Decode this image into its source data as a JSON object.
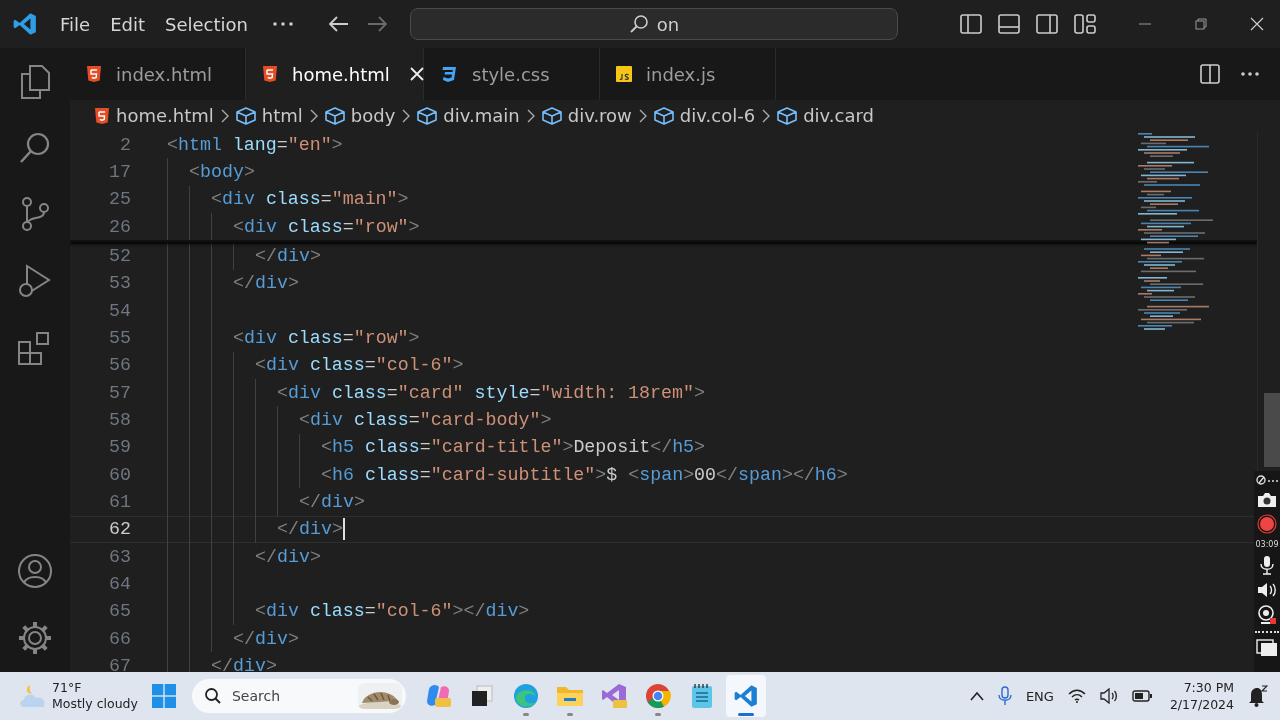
{
  "menu": [
    "File",
    "Edit",
    "Selection"
  ],
  "command_center": {
    "text": "on"
  },
  "tabs": [
    {
      "label": "index.html",
      "kind": "html",
      "selected": false
    },
    {
      "label": "home.html",
      "kind": "html",
      "selected": true
    },
    {
      "label": "style.css",
      "kind": "css",
      "selected": false
    },
    {
      "label": "index.js",
      "kind": "js",
      "selected": false
    }
  ],
  "breadcrumbs": [
    {
      "label": "home.html",
      "kind": "file"
    },
    {
      "label": "html",
      "kind": "element"
    },
    {
      "label": "body",
      "kind": "element"
    },
    {
      "label": "div.main",
      "kind": "element"
    },
    {
      "label": "div.row",
      "kind": "element"
    },
    {
      "label": "div.col-6",
      "kind": "element"
    },
    {
      "label": "div.card",
      "kind": "element"
    }
  ],
  "sticky_lines": [
    {
      "n": "2",
      "code": [
        {
          "p": "<"
        },
        {
          "tag": "html"
        },
        {
          "attr": " lang"
        },
        {
          "eq": "="
        },
        {
          "str": "\"en\""
        },
        {
          "p": ">"
        }
      ]
    },
    {
      "n": "17",
      "code": [
        {
          "p": "  <"
        },
        {
          "tag": "body"
        },
        {
          "p": ">"
        }
      ]
    },
    {
      "n": "25",
      "code": [
        {
          "p": "    <"
        },
        {
          "tag": "div"
        },
        {
          "attr": " class"
        },
        {
          "eq": "="
        },
        {
          "str": "\"main\""
        },
        {
          "p": ">"
        }
      ]
    },
    {
      "n": "26",
      "code": [
        {
          "p": "      <"
        },
        {
          "tag": "div"
        },
        {
          "attr": " class"
        },
        {
          "eq": "="
        },
        {
          "str": "\"row\""
        },
        {
          "p": ">"
        }
      ]
    }
  ],
  "lines": [
    {
      "n": "52",
      "current": false,
      "code": [
        {
          "p": "        </"
        },
        {
          "tag": "div"
        },
        {
          "p": ">"
        }
      ]
    },
    {
      "n": "53",
      "current": false,
      "code": [
        {
          "p": "      </"
        },
        {
          "tag": "div"
        },
        {
          "p": ">"
        }
      ]
    },
    {
      "n": "54",
      "current": false
    },
    {
      "n": "55",
      "current": false,
      "code": [
        {
          "p": "      <"
        },
        {
          "tag": "div"
        },
        {
          "attr": " class"
        },
        {
          "eq": "="
        },
        {
          "str": "\"row\""
        },
        {
          "p": ">"
        }
      ]
    },
    {
      "n": "56",
      "current": false,
      "code": [
        {
          "p": "        <"
        },
        {
          "tag": "div"
        },
        {
          "attr": " class"
        },
        {
          "eq": "="
        },
        {
          "str": "\"col-6\""
        },
        {
          "p": ">"
        }
      ]
    },
    {
      "n": "57",
      "current": false,
      "code": [
        {
          "p": "          <"
        },
        {
          "tag": "div"
        },
        {
          "attr": " class"
        },
        {
          "eq": "="
        },
        {
          "str": "\"card\""
        },
        {
          "attr": " style"
        },
        {
          "eq": "="
        },
        {
          "str": "\"width: 18rem\""
        },
        {
          "p": ">"
        }
      ]
    },
    {
      "n": "58",
      "current": false,
      "code": [
        {
          "p": "            <"
        },
        {
          "tag": "div"
        },
        {
          "attr": " class"
        },
        {
          "eq": "="
        },
        {
          "str": "\"card-body\""
        },
        {
          "p": ">"
        }
      ]
    },
    {
      "n": "59",
      "current": false,
      "code": [
        {
          "p": "              <"
        },
        {
          "tag": "h5"
        },
        {
          "attr": " class"
        },
        {
          "eq": "="
        },
        {
          "str": "\"card-title\""
        },
        {
          "p": ">"
        },
        {
          "text": "Deposit"
        },
        {
          "p": "</"
        },
        {
          "tag": "h5"
        },
        {
          "p": ">"
        }
      ]
    },
    {
      "n": "60",
      "current": false,
      "code": [
        {
          "p": "              <"
        },
        {
          "tag": "h6"
        },
        {
          "attr": " class"
        },
        {
          "eq": "="
        },
        {
          "str": "\"card-subtitle\""
        },
        {
          "p": ">"
        },
        {
          "text": "$ "
        },
        {
          "p": "<"
        },
        {
          "tag": "span"
        },
        {
          "p": ">"
        },
        {
          "text": "00"
        },
        {
          "p": "</"
        },
        {
          "tag": "span"
        },
        {
          "p": ">"
        },
        {
          "p": "</"
        },
        {
          "tag": "h6"
        },
        {
          "p": ">"
        }
      ]
    },
    {
      "n": "61",
      "current": false,
      "code": [
        {
          "p": "            </"
        },
        {
          "tag": "div"
        },
        {
          "p": ">"
        }
      ]
    },
    {
      "n": "62",
      "current": true,
      "code": [
        {
          "p": "          </"
        },
        {
          "tag": "div"
        },
        {
          "p": ">"
        }
      ]
    },
    {
      "n": "63",
      "current": false,
      "code": [
        {
          "p": "        </"
        },
        {
          "tag": "div"
        },
        {
          "p": ">"
        }
      ]
    },
    {
      "n": "64",
      "current": false
    },
    {
      "n": "65",
      "current": false,
      "code": [
        {
          "p": "        <"
        },
        {
          "tag": "div"
        },
        {
          "attr": " class"
        },
        {
          "eq": "="
        },
        {
          "str": "\"col-6\""
        },
        {
          "p": "></"
        },
        {
          "tag": "div"
        },
        {
          "p": ">"
        }
      ]
    },
    {
      "n": "66",
      "current": false,
      "code": [
        {
          "p": "      </"
        },
        {
          "tag": "div"
        },
        {
          "p": ">"
        }
      ]
    },
    {
      "n": "67",
      "current": false,
      "code": [
        {
          "p": "    </"
        },
        {
          "tag": "div"
        },
        {
          "p": ">"
        }
      ]
    }
  ],
  "recorder": {
    "timer": "03:09"
  },
  "taskbar": {
    "weather": {
      "temp": "71°F",
      "text": "Mostly cloudy"
    },
    "search": {
      "label": "Search"
    },
    "apps": [
      {
        "kind": "copilot",
        "running": false,
        "selected": false
      },
      {
        "kind": "task-view",
        "running": false,
        "selected": false
      },
      {
        "kind": "edge",
        "running": true,
        "selected": false
      },
      {
        "kind": "folder",
        "running": true,
        "selected": false
      },
      {
        "kind": "visual-studio",
        "running": false,
        "selected": false
      },
      {
        "kind": "chrome",
        "running": true,
        "selected": false
      },
      {
        "kind": "notepad",
        "running": false,
        "selected": false
      },
      {
        "kind": "vscode",
        "running": true,
        "selected": true
      }
    ],
    "language": "ENG",
    "time": "7:30 PM",
    "date": "2/17/2024"
  }
}
